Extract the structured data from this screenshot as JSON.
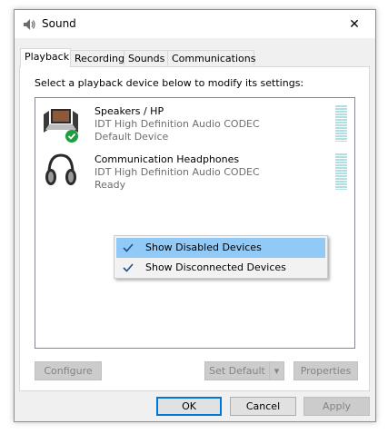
{
  "window": {
    "title": "Sound",
    "close_glyph": "✕"
  },
  "tabs": [
    {
      "label": "Playback",
      "active": true
    },
    {
      "label": "Recording"
    },
    {
      "label": "Sounds"
    },
    {
      "label": "Communications"
    }
  ],
  "panel": {
    "instruction": "Select a playback device below to modify its settings:"
  },
  "devices": [
    {
      "name": "Speakers / HP",
      "driver": "IDT High Definition Audio CODEC",
      "status": "Default Device",
      "icon": "speakers-laptop-icon",
      "default_badge": "checkmark-badge-icon"
    },
    {
      "name": "Communication Headphones",
      "driver": "IDT High Definition Audio CODEC",
      "status": "Ready",
      "icon": "headphones-icon"
    }
  ],
  "context_menu": {
    "items": [
      {
        "label": "Show Disabled Devices",
        "checked": true,
        "highlighted": true
      },
      {
        "label": "Show Disconnected Devices",
        "checked": true
      }
    ]
  },
  "panel_buttons": {
    "configure": "Configure",
    "set_default": "Set Default",
    "set_default_arrow": "▾",
    "properties": "Properties"
  },
  "dialog_buttons": {
    "ok": "OK",
    "cancel": "Cancel",
    "apply": "Apply"
  },
  "colors": {
    "menu_highlight": "#91c9f7",
    "check_badge": "#1e9e3e",
    "meter": "#b2dfe1",
    "default_button_border": "#0078d7"
  }
}
